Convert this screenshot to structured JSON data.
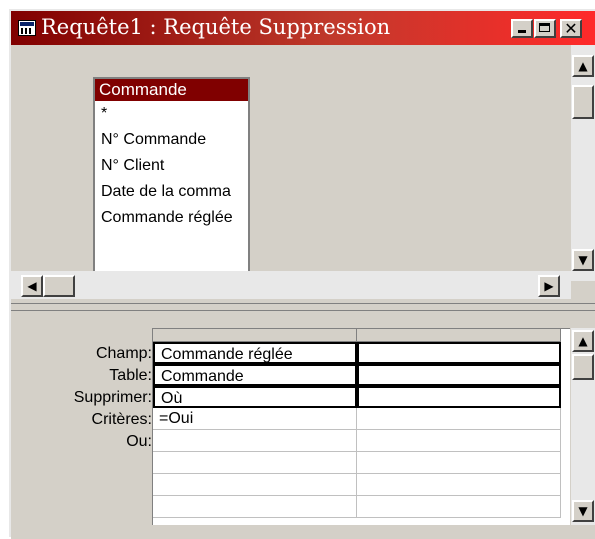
{
  "window": {
    "title": "Requête1 : Requête Suppression",
    "controls": {
      "minimize": "minimize",
      "maximize": "maximize",
      "close": "✕"
    }
  },
  "design": {
    "table": {
      "name": "Commande",
      "fields": [
        "*",
        "N° Commande",
        "N° Client",
        "Date de la comma",
        "Commande réglée"
      ]
    }
  },
  "grid": {
    "row_labels": [
      "Champ:",
      "Table:",
      "Supprimer:",
      "Critères:",
      "Ou:"
    ],
    "columns": [
      {
        "champ": "Commande réglée",
        "table": "Commande",
        "supprimer": "Où",
        "criteres": "=Oui",
        "ou": ""
      },
      {
        "champ": "",
        "table": "",
        "supprimer": "",
        "criteres": "",
        "ou": ""
      }
    ]
  },
  "icons": {
    "window": "query-icon",
    "scroll_up": "▲",
    "scroll_down": "▼",
    "scroll_left": "◀",
    "scroll_right": "▶"
  },
  "colors": {
    "title_start": "#800000",
    "title_end": "#ff2a2a",
    "table_header": "#800000",
    "chrome": "#d4d0c8"
  }
}
